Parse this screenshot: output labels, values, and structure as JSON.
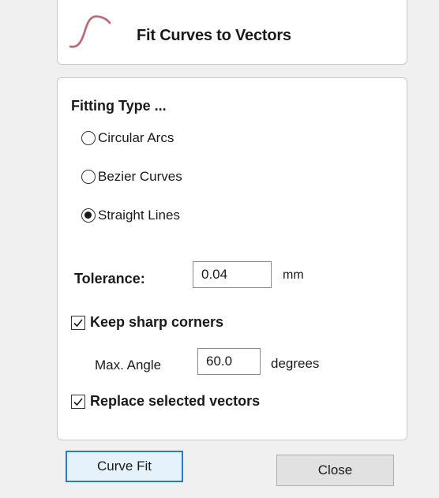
{
  "header": {
    "title": "Fit Curves to Vectors",
    "icon": "curve-icon"
  },
  "fitting_type": {
    "title": "Fitting Type ...",
    "options": [
      {
        "label": "Circular Arcs",
        "selected": false
      },
      {
        "label": "Bezier Curves",
        "selected": false
      },
      {
        "label": "Straight Lines",
        "selected": true
      }
    ]
  },
  "tolerance": {
    "label": "Tolerance:",
    "value": "0.04",
    "unit": "mm"
  },
  "keep_sharp_corners": {
    "label": "Keep sharp corners",
    "checked": true,
    "max_angle_label": "Max. Angle",
    "max_angle_value": "60.0",
    "max_angle_unit": "degrees"
  },
  "replace_selected": {
    "label": "Replace selected vectors",
    "checked": true
  },
  "buttons": {
    "curve_fit": "Curve Fit",
    "close": "Close"
  },
  "colors": {
    "background": "#f0f0f0",
    "panel": "#ffffff",
    "icon_curve": "#c9848a",
    "default_button_border": "#2b78d4",
    "default_button_fill": "#e5f1fb"
  }
}
